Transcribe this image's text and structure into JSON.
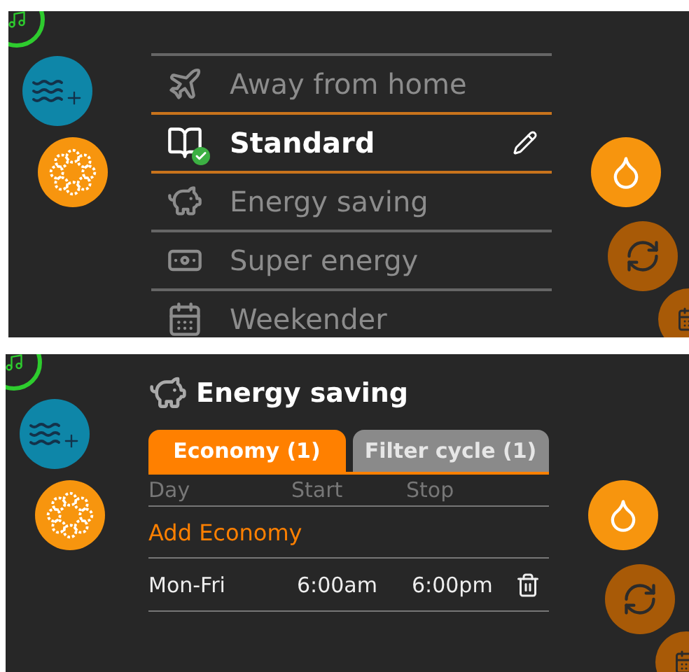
{
  "menu_screen": {
    "items": [
      {
        "label": "Away from home",
        "selected": false
      },
      {
        "label": "Standard",
        "selected": true
      },
      {
        "label": "Energy saving",
        "selected": false
      },
      {
        "label": "Super energy",
        "selected": false
      },
      {
        "label": "Weekender",
        "selected": false
      }
    ]
  },
  "detail_screen": {
    "title": "Energy saving",
    "tabs": [
      {
        "label": "Economy (1)",
        "selected": true
      },
      {
        "label": "Filter cycle (1)",
        "selected": false
      }
    ],
    "columns": [
      "Day",
      "Start",
      "Stop"
    ],
    "add_link": "Add Economy",
    "rows": [
      {
        "day": "Mon-Fri",
        "start": "6:00am",
        "stop": "6:00pm"
      }
    ]
  }
}
